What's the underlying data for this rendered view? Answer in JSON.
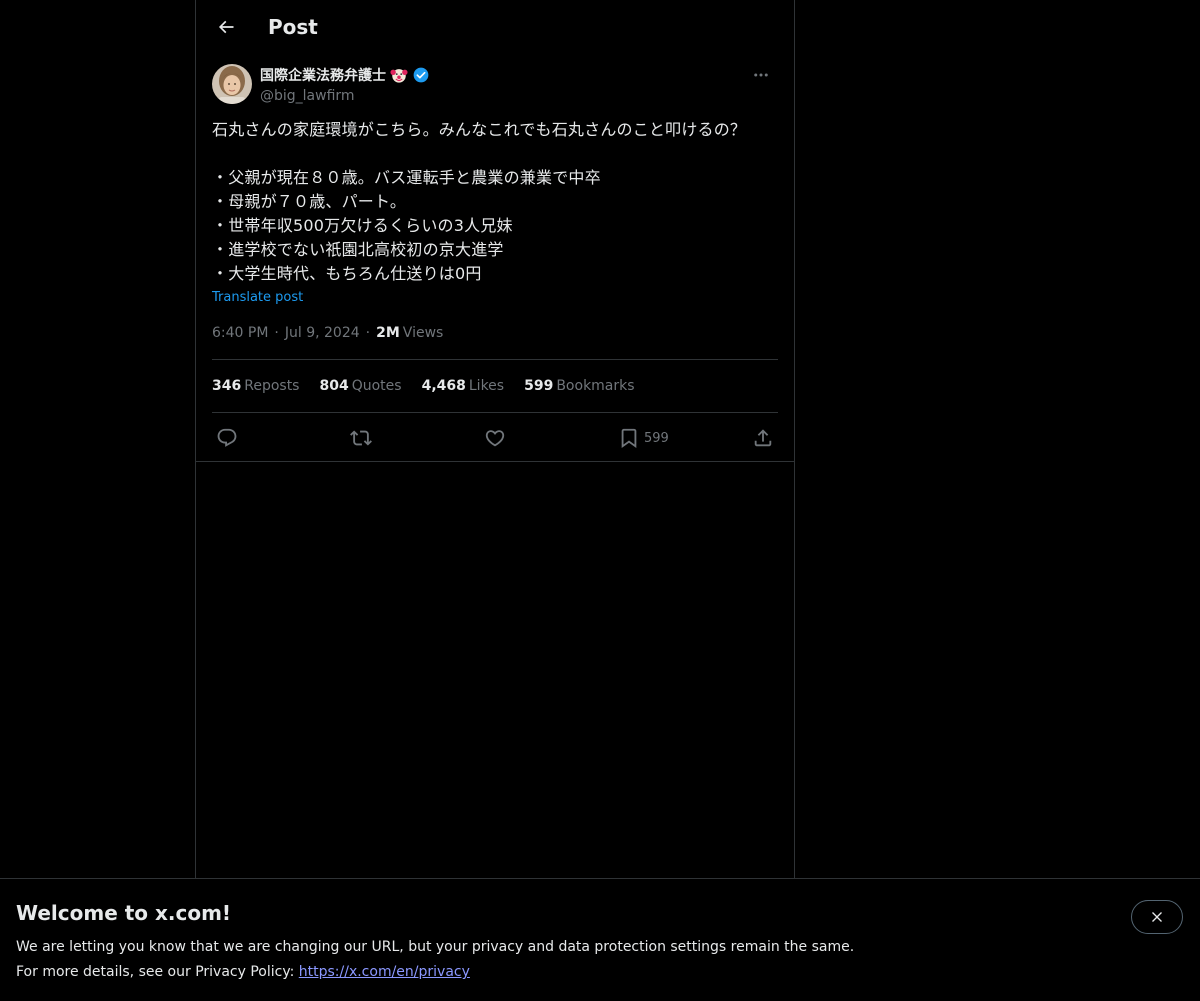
{
  "header": {
    "title": "Post"
  },
  "post": {
    "author_name": "国際企業法務弁護士",
    "handle": "@big_lawfirm",
    "text": "石丸さんの家庭環境がこちら。みんなこれでも石丸さんのこと叩けるの？\n\n・父親が現在８０歳。バス運転手と農業の兼業で中卒\n・母親が７０歳、パート。\n・世帯年収500万欠けるくらいの3人兄妹\n・進学校でない祇園北高校初の京大進学\n・大学生時代、もちろん仕送りは0円",
    "translate_label": "Translate post",
    "time": "6:40 PM",
    "date": "Jul 9, 2024",
    "views_count": "2M",
    "views_label": "Views",
    "separator": "·"
  },
  "stats": {
    "reposts_count": "346",
    "reposts_label": "Reposts",
    "quotes_count": "804",
    "quotes_label": "Quotes",
    "likes_count": "4,468",
    "likes_label": "Likes",
    "bookmarks_count": "599",
    "bookmarks_label": "Bookmarks"
  },
  "actions": {
    "bookmark_count": "599"
  },
  "banner": {
    "title": "Welcome to x.com!",
    "line1": "We are letting you know that we are changing our URL, but your privacy and data protection settings remain the same.",
    "line2_prefix": "For more details, see our Privacy Policy: ",
    "link": "https://x.com/en/privacy"
  },
  "colors": {
    "background": "#000000",
    "text": "#e7e9ea",
    "muted": "#71767b",
    "accent": "#1d9bf0",
    "link": "#8b98ff",
    "border": "#2f3336"
  },
  "icons": [
    "back-arrow-icon",
    "clown-emoji-icon",
    "verified-badge-icon",
    "more-icon",
    "reply-icon",
    "repost-icon",
    "like-icon",
    "bookmark-icon",
    "share-icon",
    "close-icon"
  ]
}
